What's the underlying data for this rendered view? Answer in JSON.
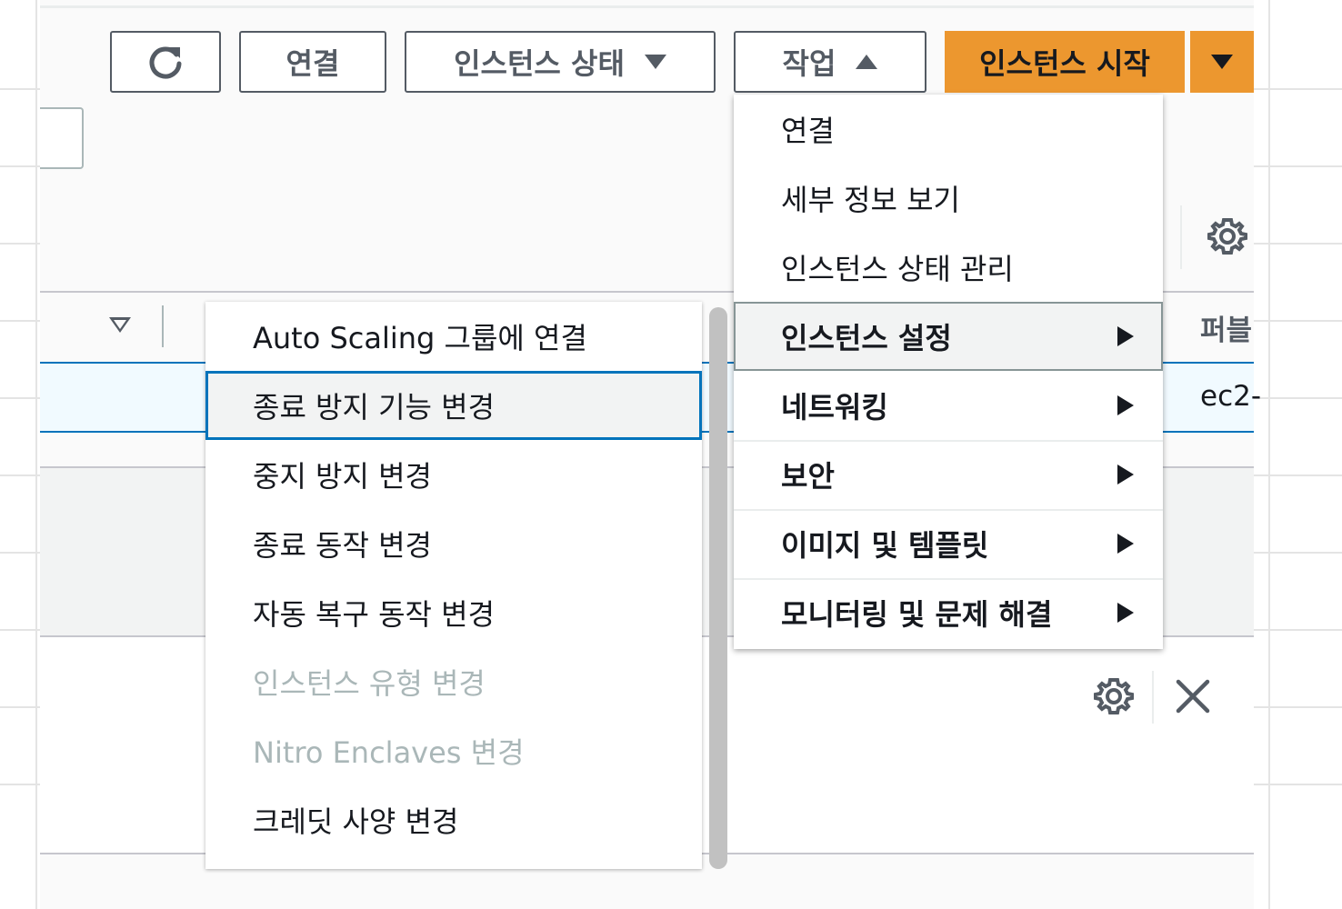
{
  "toolbar": {
    "refresh_icon": "refresh-icon",
    "connect_label": "연결",
    "instance_state_label": "인스턴스 상태",
    "actions_label": "작업",
    "launch_label": "인스턴스 시작"
  },
  "table": {
    "partial_header": "퍼블",
    "partial_cell": "ec2-"
  },
  "actions_menu": {
    "items": [
      {
        "label": "연결"
      },
      {
        "label": "세부 정보 보기"
      },
      {
        "label": "인스턴스 상태 관리"
      },
      {
        "label": "인스턴스 설정"
      },
      {
        "label": "네트워킹"
      },
      {
        "label": "보안"
      },
      {
        "label": "이미지 및 템플릿"
      },
      {
        "label": "모니터링 및 문제 해결"
      }
    ]
  },
  "instance_settings_submenu": {
    "items": [
      {
        "label": "Auto Scaling 그룹에 연결"
      },
      {
        "label": "종료 방지 기능 변경"
      },
      {
        "label": "중지 방지 변경"
      },
      {
        "label": "종료 동작 변경"
      },
      {
        "label": "자동 복구 동작 변경"
      },
      {
        "label": "인스턴스 유형 변경"
      },
      {
        "label": "Nitro Enclaves 변경"
      },
      {
        "label": "크레딧 사양 변경"
      }
    ]
  },
  "colors": {
    "primary": "#ec972f",
    "focus": "#0073bb",
    "disabled_text": "#aab7b8"
  }
}
